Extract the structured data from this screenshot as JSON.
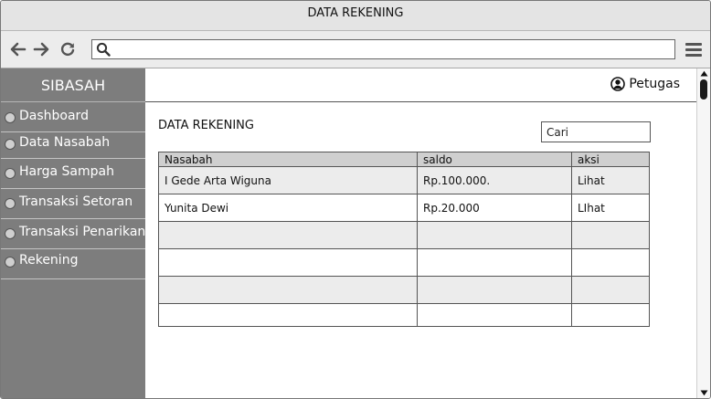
{
  "window": {
    "title": "DATA REKENING"
  },
  "browser": {
    "address_value": "",
    "address_placeholder": ""
  },
  "sidebar": {
    "brand": "SIBASAH",
    "items": [
      {
        "label": "Dashboard"
      },
      {
        "label": "Data Nasabah"
      },
      {
        "label": "Harga Sampah"
      },
      {
        "label": "Transaksi Setoran"
      },
      {
        "label": "Transaksi Penarikan"
      },
      {
        "label": "Rekening"
      }
    ]
  },
  "header": {
    "user_label": "Petugas"
  },
  "main": {
    "title": "DATA REKENING",
    "search_placeholder": "Cari",
    "table": {
      "columns": [
        "Nasabah",
        "saldo",
        "aksi"
      ],
      "rows": [
        [
          "I Gede Arta Wiguna",
          "Rp.100.000.",
          "Lihat"
        ],
        [
          "Yunita Dewi",
          "Rp.20.000",
          "LIhat"
        ],
        [
          "",
          "",
          ""
        ],
        [
          "",
          "",
          ""
        ],
        [
          "",
          "",
          ""
        ],
        [
          "",
          "",
          ""
        ]
      ]
    }
  }
}
